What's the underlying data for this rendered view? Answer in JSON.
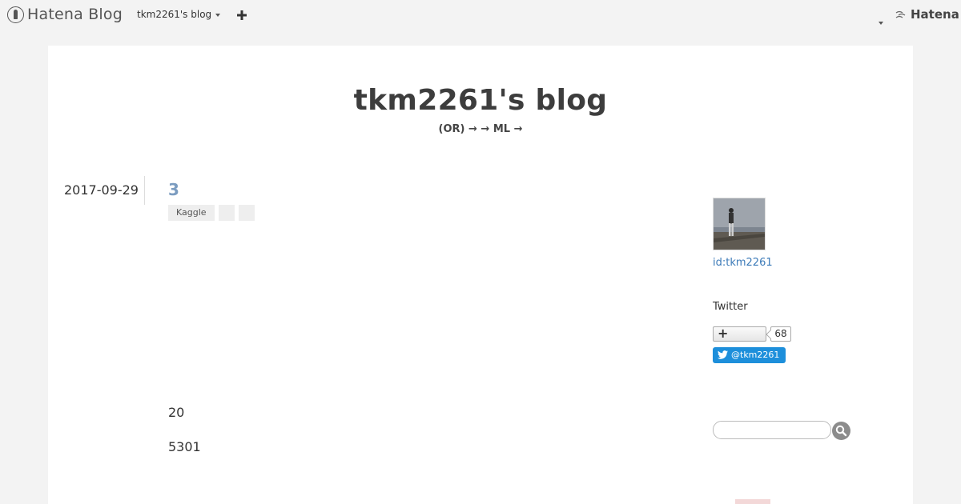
{
  "header": {
    "brand": "Hatena Blog",
    "blog_menu": "tkm2261's blog",
    "add_icon": "plus-icon",
    "account_icon": "caret-down-icon",
    "hatena_logo": "Hatena"
  },
  "blog": {
    "title": "tkm2261's blog",
    "description": "(OR) →  → ML →"
  },
  "entry": {
    "date": "2017-09-29",
    "title": "3",
    "categories": [
      "Kaggle",
      "",
      ""
    ],
    "lines": [
      "20",
      "5301"
    ]
  },
  "sidebar": {
    "profile_id": "id:tkm2261",
    "twitter_label": "Twitter",
    "follow_count": "68",
    "twitter_handle": "@tkm2261",
    "search_placeholder": ""
  },
  "colors": {
    "accent_link": "#3b7ab8",
    "entry_title": "#7b9cc0",
    "twitter_blue": "#1d8fdb"
  }
}
